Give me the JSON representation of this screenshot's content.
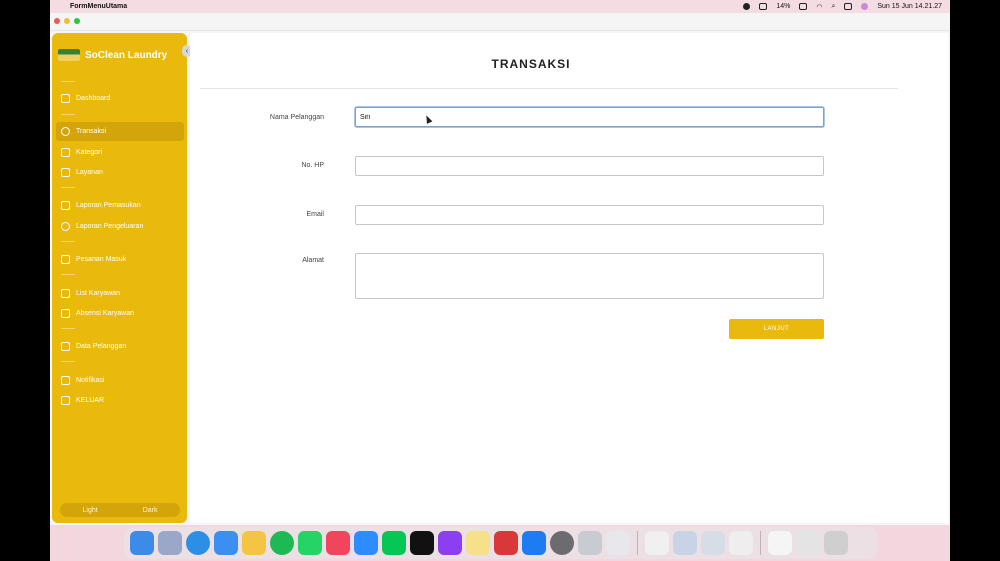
{
  "menubar": {
    "app_name": "FormMenuUtama",
    "battery": "14%",
    "datetime": "Sun 15 Jun  14.21.27"
  },
  "sidebar": {
    "brand": "SoClean Laundry",
    "items": [
      {
        "label": "Dashboard",
        "icon": "home-icon"
      },
      {
        "label": "Transaksi",
        "icon": "user-circle-icon",
        "active": true
      },
      {
        "label": "Kategori",
        "icon": "box-icon"
      },
      {
        "label": "Layanan",
        "icon": "layers-icon"
      },
      {
        "label": "Laporan Pemasukan",
        "icon": "report-icon"
      },
      {
        "label": "Laporan Pengeluaran",
        "icon": "minus-circle-icon"
      },
      {
        "label": "Pesanan Masuk",
        "icon": "cart-icon"
      },
      {
        "label": "List Karyawan",
        "icon": "users-icon"
      },
      {
        "label": "Absensi Karyawan",
        "icon": "clipboard-icon"
      },
      {
        "label": "Data Pelanggan",
        "icon": "customers-icon"
      },
      {
        "label": "Notifikasi",
        "icon": "bell-icon"
      },
      {
        "label": "KELUAR",
        "icon": "logout-icon"
      }
    ],
    "theme": {
      "light": "Light",
      "dark": "Dark"
    }
  },
  "form": {
    "title": "TRANSAKSI",
    "nama_label": "Nama Pelanggan",
    "nama_value": "Siri",
    "hp_label": "No. HP",
    "hp_value": "",
    "email_label": "Email",
    "email_value": "",
    "alamat_label": "Alamat",
    "alamat_value": "",
    "submit_label": "LANJUT"
  },
  "colors": {
    "accent": "#e9b90c",
    "sidebar_active": "#d4a50b"
  }
}
